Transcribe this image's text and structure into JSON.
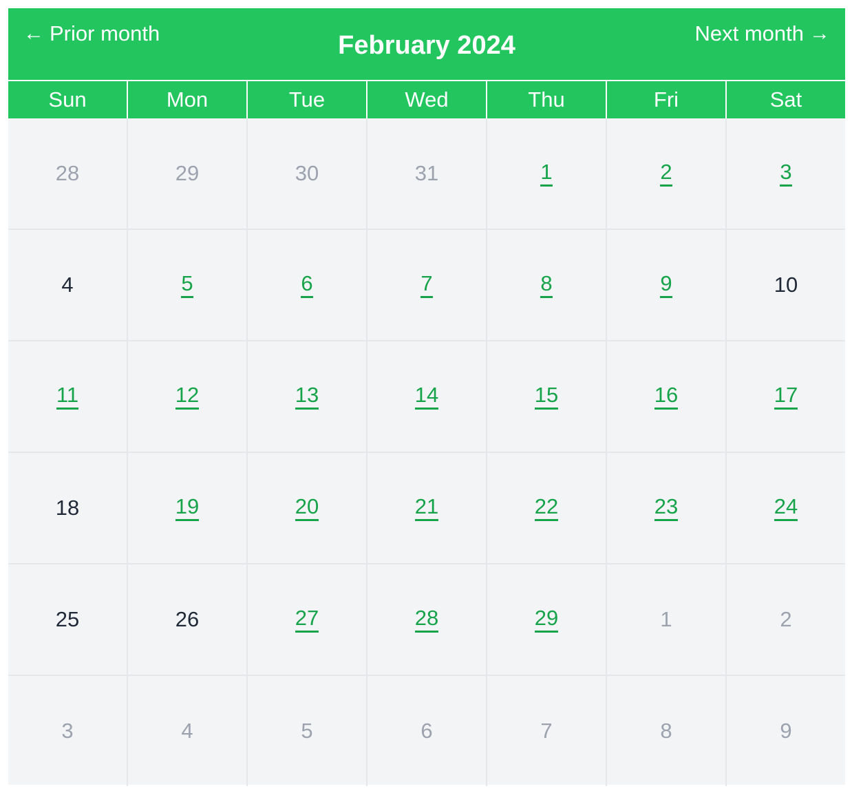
{
  "header": {
    "prior_label": "Prior month",
    "next_label": "Next month",
    "title": "February 2024",
    "left_arrow": "←",
    "right_arrow": "→"
  },
  "colors": {
    "header_bg": "#22c55e",
    "link": "#16a34a",
    "outside_day": "#9ca3af",
    "plain_day": "#1f2937",
    "grid_bg": "#f3f4f6"
  },
  "weekdays": [
    "Sun",
    "Mon",
    "Tue",
    "Wed",
    "Thu",
    "Fri",
    "Sat"
  ],
  "weeks": [
    [
      {
        "label": "28",
        "state": "outside"
      },
      {
        "label": "29",
        "state": "outside"
      },
      {
        "label": "30",
        "state": "outside"
      },
      {
        "label": "31",
        "state": "outside"
      },
      {
        "label": "1",
        "state": "link"
      },
      {
        "label": "2",
        "state": "link"
      },
      {
        "label": "3",
        "state": "link"
      }
    ],
    [
      {
        "label": "4",
        "state": "plain"
      },
      {
        "label": "5",
        "state": "link"
      },
      {
        "label": "6",
        "state": "link"
      },
      {
        "label": "7",
        "state": "link"
      },
      {
        "label": "8",
        "state": "link"
      },
      {
        "label": "9",
        "state": "link"
      },
      {
        "label": "10",
        "state": "plain"
      }
    ],
    [
      {
        "label": "11",
        "state": "link"
      },
      {
        "label": "12",
        "state": "link"
      },
      {
        "label": "13",
        "state": "link"
      },
      {
        "label": "14",
        "state": "link"
      },
      {
        "label": "15",
        "state": "link"
      },
      {
        "label": "16",
        "state": "link"
      },
      {
        "label": "17",
        "state": "link"
      }
    ],
    [
      {
        "label": "18",
        "state": "plain"
      },
      {
        "label": "19",
        "state": "link"
      },
      {
        "label": "20",
        "state": "link"
      },
      {
        "label": "21",
        "state": "link"
      },
      {
        "label": "22",
        "state": "link"
      },
      {
        "label": "23",
        "state": "link"
      },
      {
        "label": "24",
        "state": "link"
      }
    ],
    [
      {
        "label": "25",
        "state": "plain"
      },
      {
        "label": "26",
        "state": "plain"
      },
      {
        "label": "27",
        "state": "link"
      },
      {
        "label": "28",
        "state": "link"
      },
      {
        "label": "29",
        "state": "link"
      },
      {
        "label": "1",
        "state": "outside"
      },
      {
        "label": "2",
        "state": "outside"
      }
    ],
    [
      {
        "label": "3",
        "state": "outside"
      },
      {
        "label": "4",
        "state": "outside"
      },
      {
        "label": "5",
        "state": "outside"
      },
      {
        "label": "6",
        "state": "outside"
      },
      {
        "label": "7",
        "state": "outside"
      },
      {
        "label": "8",
        "state": "outside"
      },
      {
        "label": "9",
        "state": "outside"
      }
    ]
  ]
}
